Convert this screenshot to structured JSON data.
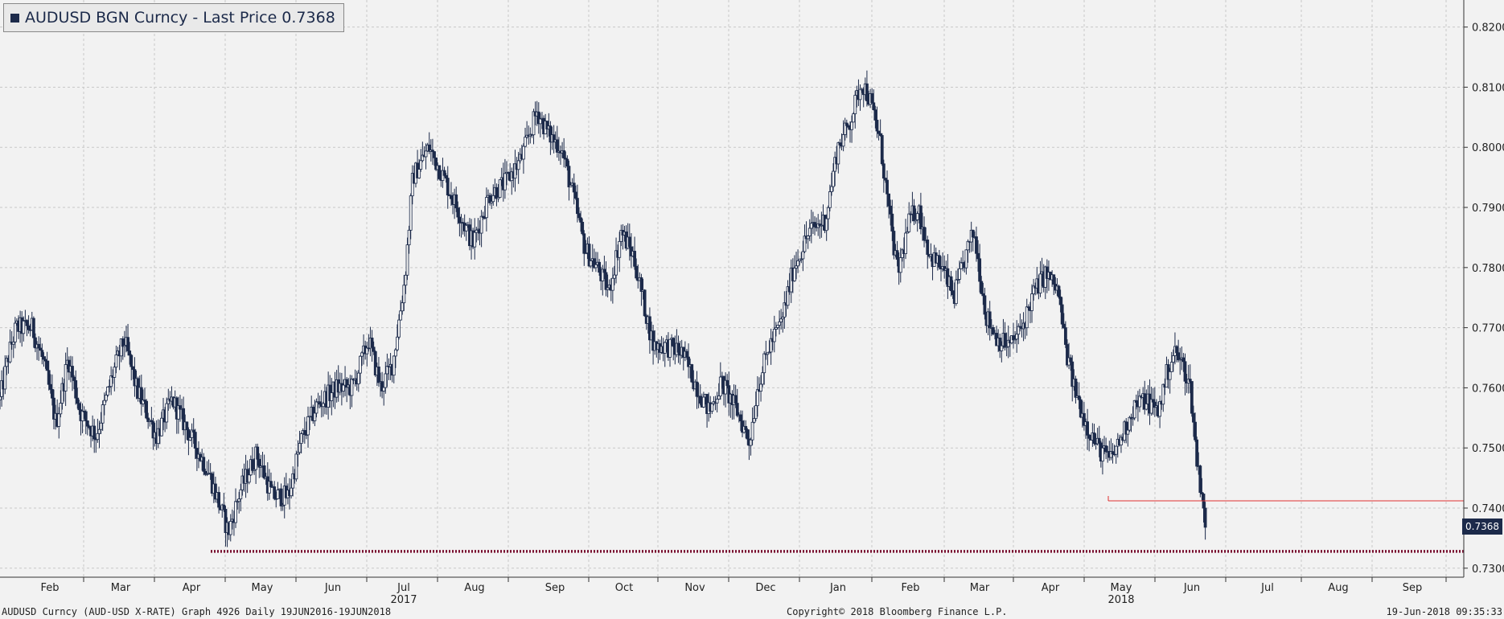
{
  "legend": {
    "label": "AUDUSD BGN Curncy - Last Price 0.7368",
    "series_color": "#1c2a4a"
  },
  "footer": {
    "left": "AUDUSD Curncy (AUD-USD X-RATE) Graph 4926  Daily 19JUN2016-19JUN2018",
    "center": "Copyright© 2018 Bloomberg Finance L.P.",
    "right": "19-Jun-2018 09:35:33"
  },
  "last_price_tag": "0.7368",
  "colors": {
    "background": "#f2f2f2",
    "candle": "#1c2a4a",
    "support_line": "#7a1030",
    "resistance_line": "#e03030",
    "grid": "#c8c8c8"
  },
  "chart_data": {
    "type": "candlestick",
    "ylim": [
      0.7285,
      0.8245
    ],
    "y_ticks": [
      "0.7300",
      "0.7400",
      "0.7500",
      "0.7600",
      "0.7700",
      "0.7800",
      "0.7900",
      "0.8000",
      "0.8100",
      "0.8200"
    ],
    "month_ticks": [
      {
        "label": "Feb",
        "year": ""
      },
      {
        "label": "Mar",
        "year": ""
      },
      {
        "label": "Apr",
        "year": ""
      },
      {
        "label": "May",
        "year": ""
      },
      {
        "label": "Jun",
        "year": ""
      },
      {
        "label": "Jul",
        "year": "2017"
      },
      {
        "label": "Aug",
        "year": ""
      },
      {
        "label": "Sep",
        "year": ""
      },
      {
        "label": "Oct",
        "year": ""
      },
      {
        "label": "Nov",
        "year": ""
      },
      {
        "label": "Dec",
        "year": ""
      },
      {
        "label": "Jan",
        "year": ""
      },
      {
        "label": "Feb",
        "year": ""
      },
      {
        "label": "Mar",
        "year": ""
      },
      {
        "label": "Apr",
        "year": ""
      },
      {
        "label": "May",
        "year": "2018"
      },
      {
        "label": "Jun",
        "year": ""
      },
      {
        "label": "Jul",
        "year": ""
      },
      {
        "label": "Aug",
        "year": ""
      },
      {
        "label": "Sep",
        "year": ""
      }
    ],
    "last_price": 0.7368,
    "support_level": 0.7328,
    "resistance_level": 0.7412,
    "path_anchors": [
      {
        "d": 0,
        "p": 0.758
      },
      {
        "d": 10,
        "p": 0.765
      },
      {
        "d": 20,
        "p": 0.77
      },
      {
        "d": 40,
        "p": 0.77
      },
      {
        "d": 55,
        "p": 0.764
      },
      {
        "d": 70,
        "p": 0.754
      },
      {
        "d": 85,
        "p": 0.765
      },
      {
        "d": 100,
        "p": 0.756
      },
      {
        "d": 120,
        "p": 0.752
      },
      {
        "d": 140,
        "p": 0.762
      },
      {
        "d": 155,
        "p": 0.768
      },
      {
        "d": 170,
        "p": 0.76
      },
      {
        "d": 195,
        "p": 0.752
      },
      {
        "d": 215,
        "p": 0.758
      },
      {
        "d": 230,
        "p": 0.754
      },
      {
        "d": 260,
        "p": 0.746
      },
      {
        "d": 275,
        "p": 0.74
      },
      {
        "d": 285,
        "p": 0.736
      },
      {
        "d": 300,
        "p": 0.743
      },
      {
        "d": 320,
        "p": 0.749
      },
      {
        "d": 340,
        "p": 0.742
      },
      {
        "d": 360,
        "p": 0.742
      },
      {
        "d": 375,
        "p": 0.751
      },
      {
        "d": 395,
        "p": 0.757
      },
      {
        "d": 420,
        "p": 0.76
      },
      {
        "d": 440,
        "p": 0.76
      },
      {
        "d": 460,
        "p": 0.768
      },
      {
        "d": 475,
        "p": 0.76
      },
      {
        "d": 490,
        "p": 0.764
      },
      {
        "d": 505,
        "p": 0.778
      },
      {
        "d": 515,
        "p": 0.795
      },
      {
        "d": 535,
        "p": 0.8
      },
      {
        "d": 550,
        "p": 0.796
      },
      {
        "d": 570,
        "p": 0.79
      },
      {
        "d": 590,
        "p": 0.784
      },
      {
        "d": 610,
        "p": 0.792
      },
      {
        "d": 630,
        "p": 0.794
      },
      {
        "d": 650,
        "p": 0.798
      },
      {
        "d": 670,
        "p": 0.806
      },
      {
        "d": 685,
        "p": 0.802
      },
      {
        "d": 700,
        "p": 0.8
      },
      {
        "d": 715,
        "p": 0.792
      },
      {
        "d": 730,
        "p": 0.783
      },
      {
        "d": 745,
        "p": 0.78
      },
      {
        "d": 760,
        "p": 0.776
      },
      {
        "d": 775,
        "p": 0.786
      },
      {
        "d": 790,
        "p": 0.782
      },
      {
        "d": 800,
        "p": 0.776
      },
      {
        "d": 815,
        "p": 0.767
      },
      {
        "d": 830,
        "p": 0.767
      },
      {
        "d": 850,
        "p": 0.766
      },
      {
        "d": 870,
        "p": 0.76
      },
      {
        "d": 885,
        "p": 0.756
      },
      {
        "d": 900,
        "p": 0.761
      },
      {
        "d": 920,
        "p": 0.756
      },
      {
        "d": 935,
        "p": 0.751
      },
      {
        "d": 945,
        "p": 0.76
      },
      {
        "d": 960,
        "p": 0.767
      },
      {
        "d": 975,
        "p": 0.771
      },
      {
        "d": 990,
        "p": 0.78
      },
      {
        "d": 1010,
        "p": 0.786
      },
      {
        "d": 1030,
        "p": 0.788
      },
      {
        "d": 1045,
        "p": 0.8
      },
      {
        "d": 1060,
        "p": 0.804
      },
      {
        "d": 1075,
        "p": 0.811
      },
      {
        "d": 1085,
        "p": 0.808
      },
      {
        "d": 1098,
        "p": 0.801
      },
      {
        "d": 1110,
        "p": 0.788
      },
      {
        "d": 1120,
        "p": 0.779
      },
      {
        "d": 1135,
        "p": 0.788
      },
      {
        "d": 1145,
        "p": 0.79
      },
      {
        "d": 1160,
        "p": 0.782
      },
      {
        "d": 1175,
        "p": 0.78
      },
      {
        "d": 1190,
        "p": 0.775
      },
      {
        "d": 1205,
        "p": 0.782
      },
      {
        "d": 1215,
        "p": 0.786
      },
      {
        "d": 1230,
        "p": 0.772
      },
      {
        "d": 1245,
        "p": 0.768
      },
      {
        "d": 1260,
        "p": 0.767
      },
      {
        "d": 1275,
        "p": 0.77
      },
      {
        "d": 1290,
        "p": 0.776
      },
      {
        "d": 1305,
        "p": 0.779
      },
      {
        "d": 1320,
        "p": 0.776
      },
      {
        "d": 1330,
        "p": 0.766
      },
      {
        "d": 1340,
        "p": 0.76
      },
      {
        "d": 1355,
        "p": 0.754
      },
      {
        "d": 1370,
        "p": 0.75
      },
      {
        "d": 1385,
        "p": 0.748
      },
      {
        "d": 1400,
        "p": 0.752
      },
      {
        "d": 1415,
        "p": 0.757
      },
      {
        "d": 1430,
        "p": 0.758
      },
      {
        "d": 1445,
        "p": 0.756
      },
      {
        "d": 1455,
        "p": 0.762
      },
      {
        "d": 1465,
        "p": 0.766
      },
      {
        "d": 1475,
        "p": 0.764
      },
      {
        "d": 1485,
        "p": 0.76
      },
      {
        "d": 1493,
        "p": 0.748
      },
      {
        "d": 1500,
        "p": 0.742
      },
      {
        "d": 1505,
        "p": 0.7368
      }
    ]
  }
}
